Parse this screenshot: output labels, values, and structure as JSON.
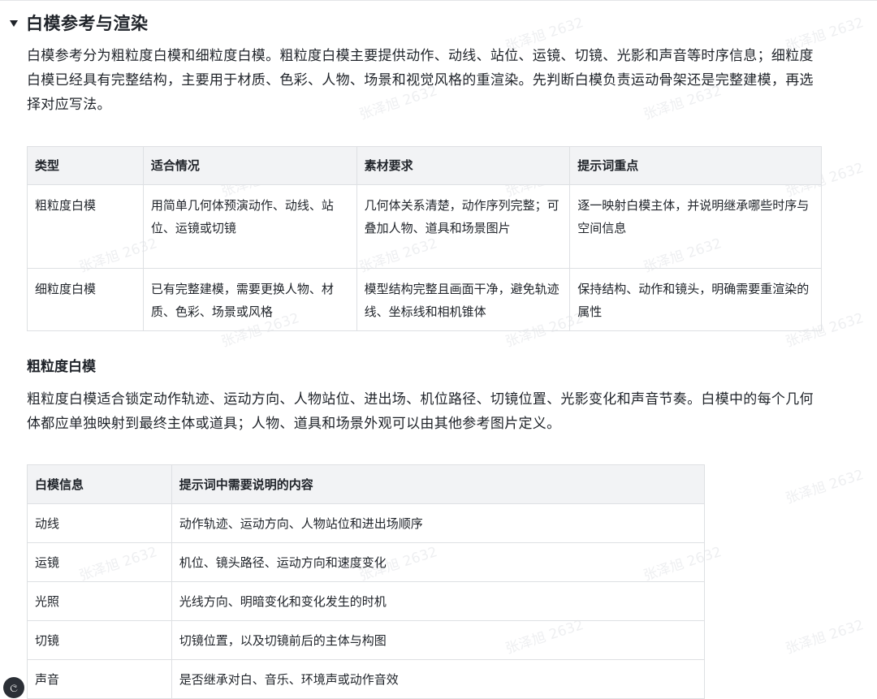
{
  "section": {
    "title": "白模参考与渲染",
    "intro": "白模参考分为粗粒度白模和细粒度白模。粗粒度白模主要提供动作、动线、站位、运镜、切镜、光影和声音等时序信息；细粒度白模已经具有完整结构，主要用于材质、色彩、人物、场景和视觉风格的重渲染。先判断白模负责运动骨架还是完整建模，再选择对应写法。"
  },
  "types_table": {
    "headers": [
      "类型",
      "适合情况",
      "素材要求",
      "提示词重点"
    ],
    "rows": [
      [
        "粗粒度白模",
        "用简单几何体预演动作、动线、站位、运镜或切镜",
        "几何体关系清楚，动作序列完整；可叠加人物、道具和场景图片",
        "逐一映射白模主体，并说明继承哪些时序与空间信息"
      ],
      [
        "细粒度白模",
        "已有完整建模，需要更换人物、材质、色彩、场景或风格",
        "模型结构完整且画面干净，避免轨迹线、坐标线和相机锥体",
        "保持结构、动作和镜头，明确需要重渲染的属性"
      ]
    ]
  },
  "coarse": {
    "heading": "粗粒度白模",
    "text": "粗粒度白模适合锁定动作轨迹、运动方向、人物站位、进出场、机位路径、切镜位置、光影变化和声音节奏。白模中的每个几何体都应单独映射到最终主体或道具；人物、道具和场景外观可以由其他参考图片定义。"
  },
  "info_table": {
    "headers": [
      "白模信息",
      "提示词中需要说明的内容"
    ],
    "rows": [
      [
        "动线",
        "动作轨迹、运动方向、人物站位和进出场顺序"
      ],
      [
        "运镜",
        "机位、镜头路径、运动方向和速度变化"
      ],
      [
        "光照",
        "光线方向、明暗变化和变化发生的时机"
      ],
      [
        "切镜",
        "切镜位置，以及切镜前后的主体与构图"
      ],
      [
        "声音",
        "是否继承对白、音乐、环境声或动作音效"
      ]
    ]
  },
  "watermark": {
    "text": "张泽旭 2632"
  },
  "corner_badge": {
    "text": "ල"
  }
}
